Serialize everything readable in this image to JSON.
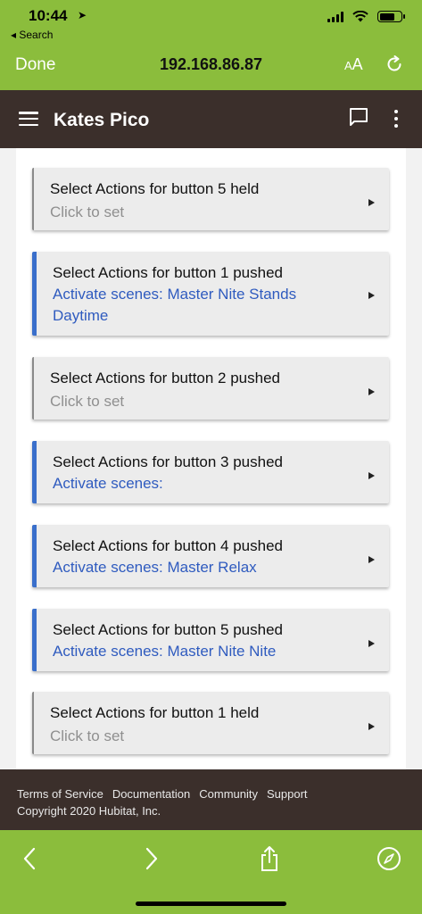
{
  "status_bar": {
    "time": "10:44",
    "back_app": "◂ Search"
  },
  "browser": {
    "done_label": "Done",
    "url": "192.168.86.87",
    "text_size_label": "AA"
  },
  "app_header": {
    "title": "Kates Pico"
  },
  "actions": [
    {
      "title": "Select Actions for button 5 held",
      "value": "Click to set",
      "state": "unset"
    },
    {
      "title": "Select Actions for button 1 pushed",
      "value": "Activate scenes: Master Nite Stands Daytime",
      "state": "set"
    },
    {
      "title": "Select Actions for button 2 pushed",
      "value": "Click to set",
      "state": "unset"
    },
    {
      "title": "Select Actions for button 3 pushed",
      "value": "Activate scenes:",
      "state": "set"
    },
    {
      "title": "Select Actions for button 4 pushed",
      "value": "Activate scenes: Master Relax",
      "state": "set"
    },
    {
      "title": "Select Actions for button 5 pushed",
      "value": "Activate scenes: Master Nite Nite",
      "state": "set"
    },
    {
      "title": "Select Actions for button 1 held",
      "value": "Click to set",
      "state": "unset"
    }
  ],
  "footer": {
    "links": [
      "Terms of Service",
      "Documentation",
      "Community",
      "Support"
    ],
    "copyright": "Copyright 2020 Hubitat, Inc."
  },
  "toolbar": {
    "buttons": [
      "back-icon",
      "forward-icon",
      "share-icon",
      "compass-icon"
    ]
  },
  "colors": {
    "browser_chrome": "#8bbd3c",
    "app_header": "#3b2f2b",
    "active_accent": "#3a6fcb",
    "set_value": "#2f5bbf",
    "unset_value": "#8f8f8f"
  }
}
